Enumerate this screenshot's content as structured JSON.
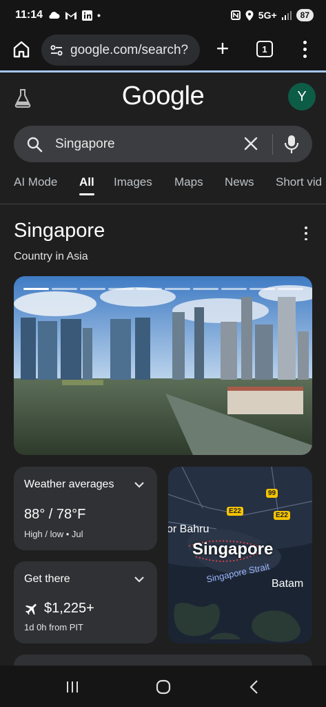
{
  "status_bar": {
    "time": "11:14",
    "network": "5G+",
    "battery": "87",
    "left_icons": [
      "cloud-icon",
      "gmail-icon",
      "linkedin-icon",
      "dot-icon"
    ],
    "right_icons": [
      "nfc-icon",
      "location-icon",
      "signal-icon",
      "battery-icon"
    ]
  },
  "browser": {
    "url": "google.com/search?",
    "tab_count": "1",
    "load_progress": 1.0
  },
  "google": {
    "logo": "Google",
    "avatar_letter": "Y",
    "search_value": "Singapore"
  },
  "tabs": [
    {
      "label": "AI Mode",
      "active": false
    },
    {
      "label": "All",
      "active": true
    },
    {
      "label": "Images",
      "active": false
    },
    {
      "label": "Maps",
      "active": false
    },
    {
      "label": "News",
      "active": false
    },
    {
      "label": "Short vid",
      "active": false
    }
  ],
  "knowledge_panel": {
    "title": "Singapore",
    "subtitle": "Country in Asia",
    "photo_indicator_count": 10,
    "weather": {
      "heading": "Weather averages",
      "temps": "88° / 78°F",
      "caption": "High / low • Jul"
    },
    "get_there": {
      "heading": "Get there",
      "price": "$1,225+",
      "caption": "1d 0h from PIT"
    },
    "map": {
      "labels": {
        "bahru": "or Bahru",
        "singapore": "Singapore",
        "strait": "Singapore Strait",
        "batam": "Batam"
      },
      "road_shields": [
        "99",
        "E22",
        "E22"
      ]
    }
  },
  "colors": {
    "background": "#1f1f1f",
    "card": "#303134",
    "avatar": "#0d5c46",
    "accent_progress": "#a8c7fa"
  }
}
